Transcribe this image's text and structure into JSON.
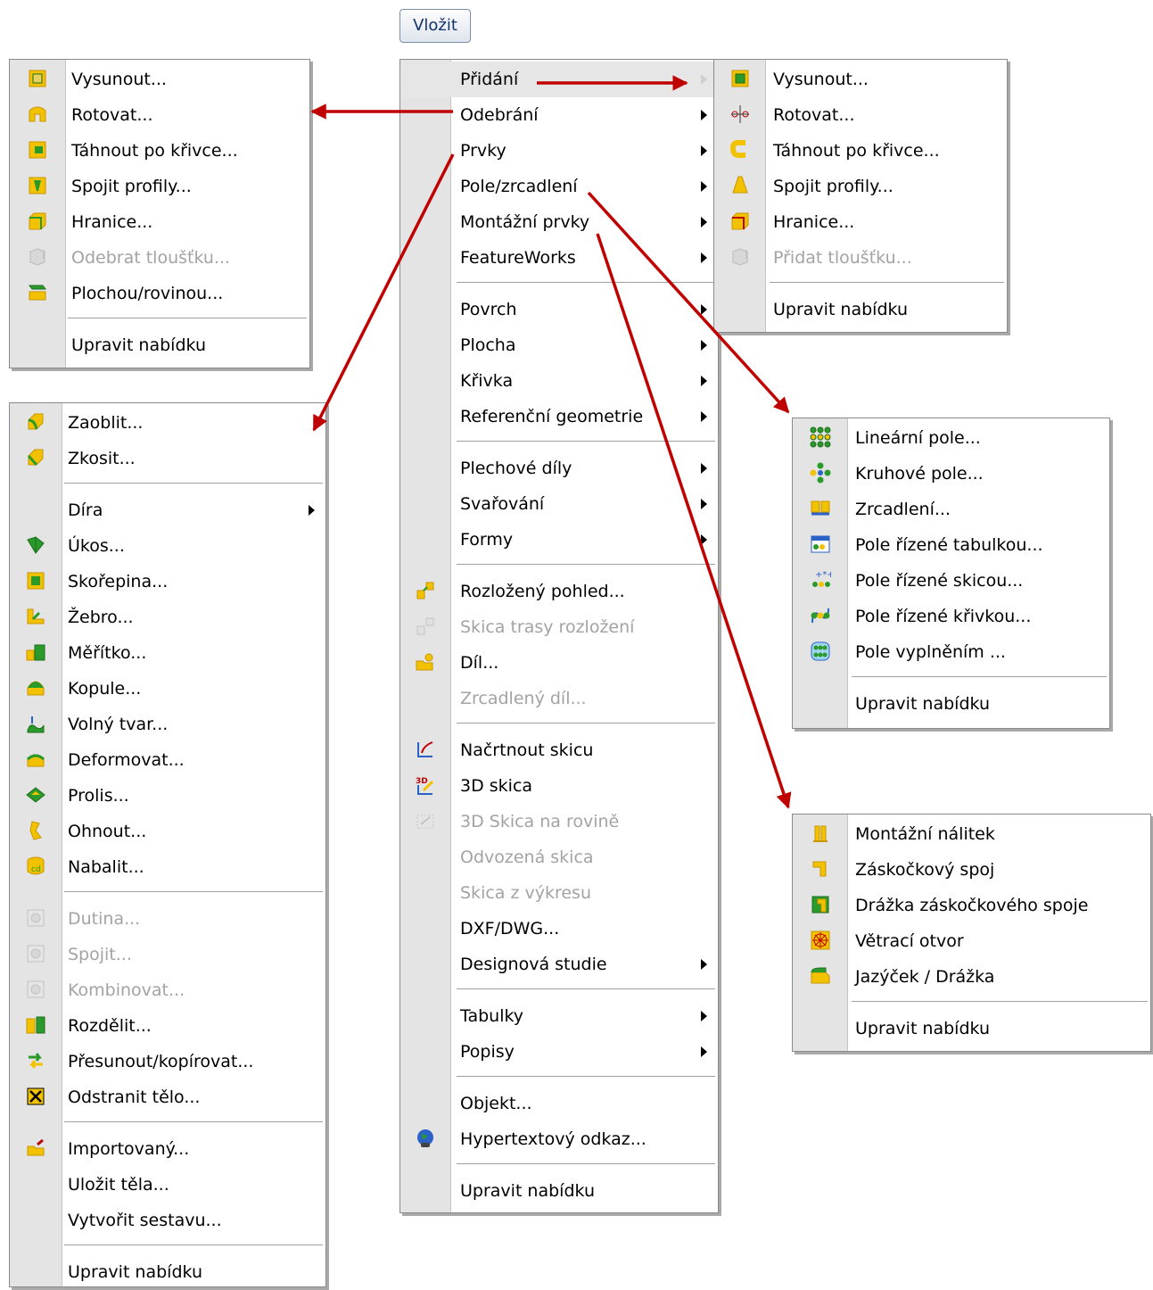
{
  "menubar": {
    "insert_label": "Vložit"
  },
  "main_menu": {
    "items": [
      {
        "label": "Přidání",
        "submenu": true,
        "highlighted": true
      },
      {
        "label": "Odebrání",
        "submenu": true
      },
      {
        "label": "Prvky",
        "submenu": true
      },
      {
        "label": "Pole/zrcadlení",
        "submenu": true
      },
      {
        "label": "Montážní prvky",
        "submenu": true
      },
      {
        "label": "FeatureWorks",
        "submenu": true
      },
      {
        "separator": true
      },
      {
        "label": "Povrch",
        "submenu": true
      },
      {
        "label": "Plocha",
        "submenu": true
      },
      {
        "label": "Křivka",
        "submenu": true
      },
      {
        "label": "Referenční geometrie",
        "submenu": true
      },
      {
        "separator": true
      },
      {
        "label": "Plechové díly",
        "submenu": true
      },
      {
        "label": "Svařování",
        "submenu": true
      },
      {
        "label": "Formy",
        "submenu": true
      },
      {
        "separator": true
      },
      {
        "label": "Rozložený pohled...",
        "icon": "exploded-view-icon"
      },
      {
        "label": "Skica trasy rozložení",
        "icon": "explode-line-sketch-icon",
        "disabled": true
      },
      {
        "label": "Díl...",
        "icon": "part-icon"
      },
      {
        "label": "Zrcadlený díl...",
        "disabled": true
      },
      {
        "separator": true
      },
      {
        "label": "Načrtnout skicu",
        "icon": "sketch-icon"
      },
      {
        "label": "3D skica",
        "icon": "3d-sketch-icon"
      },
      {
        "label": "3D Skica na rovině",
        "icon": "3d-sketch-on-plane-icon",
        "disabled": true
      },
      {
        "label": "Odvozená skica",
        "disabled": true
      },
      {
        "label": "Skica z výkresu",
        "disabled": true
      },
      {
        "label": "DXF/DWG..."
      },
      {
        "label": "Designová studie",
        "submenu": true
      },
      {
        "separator": true
      },
      {
        "label": "Tabulky",
        "submenu": true
      },
      {
        "label": "Popisy",
        "submenu": true
      },
      {
        "separator": true
      },
      {
        "label": "Objekt..."
      },
      {
        "label": "Hypertextový odkaz...",
        "icon": "hyperlink-globe-icon"
      },
      {
        "separator": true
      },
      {
        "label": "Upravit nabídku"
      }
    ]
  },
  "add_menu": {
    "items": [
      {
        "label": "Vysunout...",
        "icon": "extruded-boss-icon"
      },
      {
        "label": "Rotovat...",
        "icon": "revolved-boss-icon"
      },
      {
        "label": "Táhnout po křivce...",
        "icon": "swept-boss-icon"
      },
      {
        "label": "Spojit profily...",
        "icon": "lofted-boss-icon"
      },
      {
        "label": "Hranice...",
        "icon": "boundary-boss-icon"
      },
      {
        "label": "Přidat tloušťku...",
        "icon": "thicken-icon",
        "disabled": true
      },
      {
        "separator": true
      },
      {
        "label": "Upravit nabídku"
      }
    ]
  },
  "remove_menu": {
    "items": [
      {
        "label": "Vysunout...",
        "icon": "extruded-cut-icon"
      },
      {
        "label": "Rotovat...",
        "icon": "revolved-cut-icon"
      },
      {
        "label": "Táhnout po křivce...",
        "icon": "swept-cut-icon"
      },
      {
        "label": "Spojit profily...",
        "icon": "lofted-cut-icon"
      },
      {
        "label": "Hranice...",
        "icon": "boundary-cut-icon"
      },
      {
        "label": "Odebrat tloušťku...",
        "icon": "thicken-cut-icon",
        "disabled": true
      },
      {
        "label": "Plochou/rovinou...",
        "icon": "surface-cut-icon"
      },
      {
        "separator": true
      },
      {
        "label": "Upravit nabídku"
      }
    ]
  },
  "features_menu": {
    "items": [
      {
        "label": "Zaoblit...",
        "icon": "fillet-icon"
      },
      {
        "label": "Zkosit...",
        "icon": "chamfer-icon"
      },
      {
        "separator": true
      },
      {
        "label": "Díra",
        "submenu": true
      },
      {
        "label": "Úkos...",
        "icon": "draft-icon"
      },
      {
        "label": "Skořepina...",
        "icon": "shell-icon"
      },
      {
        "label": "Žebro...",
        "icon": "rib-icon"
      },
      {
        "label": "Měřítko...",
        "icon": "scale-icon"
      },
      {
        "label": "Kopule...",
        "icon": "dome-icon"
      },
      {
        "label": "Volný tvar...",
        "icon": "freeform-icon"
      },
      {
        "label": "Deformovat...",
        "icon": "deform-icon"
      },
      {
        "label": "Prolis...",
        "icon": "indent-icon"
      },
      {
        "label": "Ohnout...",
        "icon": "flex-icon"
      },
      {
        "label": "Nabalit...",
        "icon": "wrap-icon"
      },
      {
        "separator": true
      },
      {
        "label": "Dutina...",
        "icon": "cavity-icon",
        "disabled": true
      },
      {
        "label": "Spojit...",
        "icon": "join-icon",
        "disabled": true
      },
      {
        "label": "Kombinovat...",
        "icon": "combine-icon",
        "disabled": true
      },
      {
        "label": "Rozdělit...",
        "icon": "split-icon"
      },
      {
        "label": "Přesunout/kopírovat...",
        "icon": "move-copy-icon"
      },
      {
        "label": "Odstranit tělo...",
        "icon": "delete-body-icon"
      },
      {
        "separator": true
      },
      {
        "label": "Importovaný...",
        "icon": "imported-icon"
      },
      {
        "label": "Uložit těla..."
      },
      {
        "label": "Vytvořit sestavu..."
      },
      {
        "separator": true
      },
      {
        "label": "Upravit nabídku"
      }
    ]
  },
  "pattern_menu": {
    "items": [
      {
        "label": "Lineární pole...",
        "icon": "linear-pattern-icon"
      },
      {
        "label": "Kruhové pole...",
        "icon": "circular-pattern-icon"
      },
      {
        "label": "Zrcadlení...",
        "icon": "mirror-icon"
      },
      {
        "label": "Pole řízené tabulkou...",
        "icon": "table-pattern-icon"
      },
      {
        "label": "Pole řízené skicou...",
        "icon": "sketch-pattern-icon"
      },
      {
        "label": "Pole řízené křivkou...",
        "icon": "curve-pattern-icon"
      },
      {
        "label": "Pole vyplněním ...",
        "icon": "fill-pattern-icon"
      },
      {
        "separator": true
      },
      {
        "label": "Upravit nabídku"
      }
    ]
  },
  "fastening_menu": {
    "items": [
      {
        "label": "Montážní nálitek",
        "icon": "mounting-boss-icon"
      },
      {
        "label": "Záskočkový spoj",
        "icon": "snap-hook-icon"
      },
      {
        "label": "Drážka záskočkového spoje",
        "icon": "snap-hook-groove-icon"
      },
      {
        "label": "Větrací otvor",
        "icon": "vent-icon"
      },
      {
        "label": "Jazýček / Drážka",
        "icon": "lip-groove-icon"
      },
      {
        "separator": true
      },
      {
        "label": "Upravit nabídku"
      }
    ]
  },
  "colors": {
    "arrow": "#c00000",
    "icon_yellow": "#f2c200",
    "icon_green": "#2a9a2a"
  }
}
